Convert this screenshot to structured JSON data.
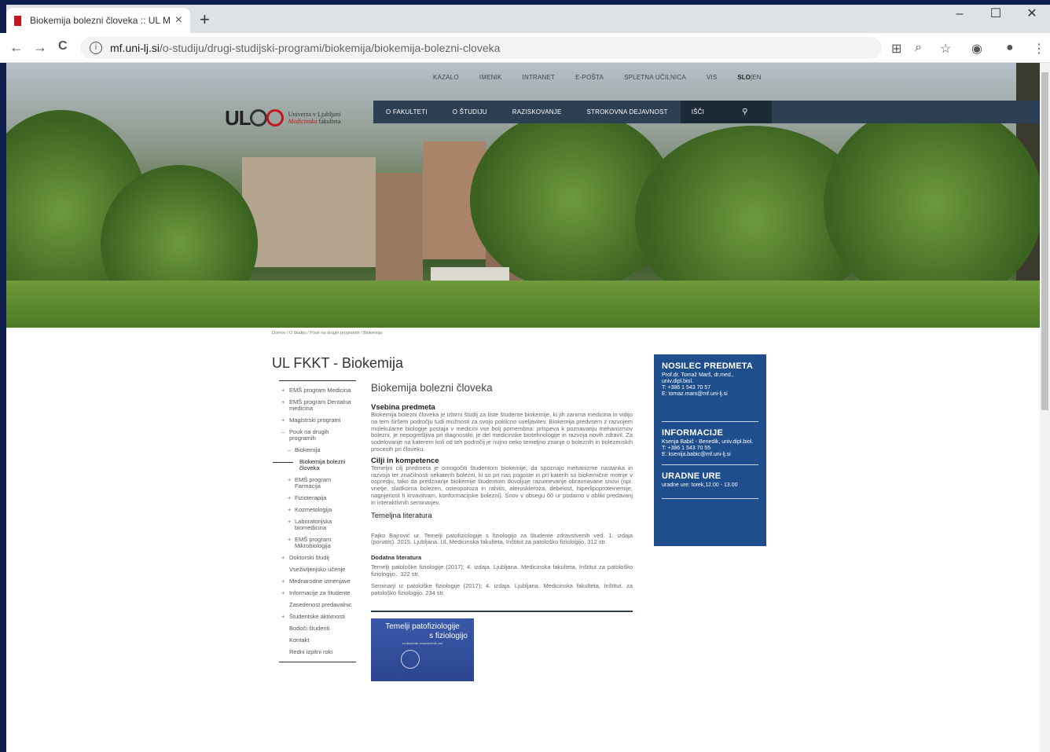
{
  "browser": {
    "tab_title": "Biokemija bolezni človeka :: UL M",
    "tab_close": "×",
    "new_tab": "+",
    "url_host": "mf.uni-lj.si",
    "url_path": "/o-studiju/drugi-studijski-programi/biokemija/biokemija-bolezni-cloveka",
    "info_glyph": "i",
    "min_glyph": "–",
    "max_glyph": "☐",
    "close_glyph": "✕",
    "back_glyph": "←",
    "forward_glyph": "→",
    "reload_glyph": "C",
    "translate_glyph": "⊞",
    "zoom_glyph": "⌕",
    "star_glyph": "☆",
    "ext_glyph": "◉",
    "profile_glyph": "●",
    "menu_glyph": "⋮"
  },
  "utility_nav": [
    "KAZALO",
    "IMENIK",
    "INTRANET",
    "E-POŠTA",
    "SPLETNA UČILNICA",
    "VIS"
  ],
  "lang": {
    "slo": "SLO",
    "sep": " | ",
    "en": "EN"
  },
  "logo": {
    "ul": "UL",
    "line1": "Univerza v Ljubljani",
    "line2a": "Medicinska",
    "line2b": " fakulteta"
  },
  "main_nav": {
    "items": [
      "O FAKULTETI",
      "O ŠTUDIJU",
      "RAZISKOVANJE",
      "STROKOVNA DEJAVNOST"
    ],
    "search": "IŠČI",
    "search_glyph": "⚲"
  },
  "breadcrumb": "Domov / O študiju / Pouk na drugih programih / Biokemija",
  "page_title": "UL FKKT - Biokemija",
  "left_nav": [
    {
      "label": "EMŠ program Medicina",
      "bullet": "+",
      "level": 0
    },
    {
      "label": "EMŠ program Dentalna medicina",
      "bullet": "+",
      "level": 0
    },
    {
      "label": "Magistrski programi",
      "bullet": "+",
      "level": 0
    },
    {
      "label": "Pouk na drugih programih",
      "bullet": "–",
      "level": 0
    },
    {
      "label": "Biokemija",
      "bullet": "–",
      "level": 1
    },
    {
      "label": "Biokemija bolezni človeka",
      "bullet": "",
      "level": 2
    },
    {
      "label": "EMŠ program Farmacija",
      "bullet": "+",
      "level": 1
    },
    {
      "label": "Fizioterapija",
      "bullet": "+",
      "level": 1
    },
    {
      "label": "Kozmetologija",
      "bullet": "+",
      "level": 1
    },
    {
      "label": "Laboratorijska biomedicina",
      "bullet": "+",
      "level": 1
    },
    {
      "label": "EMŠ program Mikrobiologija",
      "bullet": "+",
      "level": 1
    },
    {
      "label": "Doktorski študij",
      "bullet": "+",
      "level": 0
    },
    {
      "label": "Vseživljenjsko učenje",
      "bullet": "",
      "level": 0
    },
    {
      "label": "Mednarodne izmenjave",
      "bullet": "+",
      "level": 0
    },
    {
      "label": "Informacije za študente",
      "bullet": "+",
      "level": 0
    },
    {
      "label": "Zasedenost predavalnic",
      "bullet": "",
      "level": 0
    },
    {
      "label": "Študentske aktivnosti",
      "bullet": "+",
      "level": 0
    },
    {
      "label": "Bodoči študenti",
      "bullet": "",
      "level": 0
    },
    {
      "label": "Kontakt",
      "bullet": "",
      "level": 0
    },
    {
      "label": "Redni izpitni roki",
      "bullet": "",
      "level": 0
    }
  ],
  "content": {
    "title": "Biokemija bolezni človeka",
    "h_vsebina": "Vsebina predmeta",
    "vsebina": "Biokemija bolezni človeka je izbirni študij za tiste študente biokemije, ki jih zanima medicina in vidijo na tem širšem področju tudi možnosti za svojo poklicno uveljavitev. Biokemija predvsem z razvojem molekularne biologije postaja v medicini vse bolj pomembna: prispeva k poznavanju mehanizmov bolezni, je nepogrešljiva pri diagnostiki, je del medicinske biotehnologije in razvoja novih zdravil. Za sodelovanje na katerem koli od teh področij je nujno neko temeljno znanje o boleznih in bolezenskih procesih pri človeku.",
    "h_cilji": "Cilji in kompetence",
    "cilji": "Temeljni cilj predmeta je omogočiti študentom biokemije, da spoznajo mehanizme nastanka in razvoja ter značilnosti nekaterih bolezni, ki so pri nas pogoste in pri katerih so biokemične motnje v ospredju, tako da predznanje biokemije študentom dovoljuje razumevanje obravnavane snovi (npr. vnetje, sladkorna bolezen, osteoporoza in rahitis, ateroskleroza, debelost, hiperlipoproteinemije, nagnjenost h krvavitvam, konformacijske bolezni). Snov v obsegu 60 ur podamo v obliki predavanj in interaktivnih seminarjev.",
    "h_temeljna": "Temeljna literatura",
    "temeljna": "Fajko Bajrović ur. Temelji patofiziologije s fiziologijo za študente zdravstvenih ved. 1. izdaja (ponatis). 2015. Ljubljana. UL Medicinska fakulteta, Inštitut za patološko fiziologijo. 312 str.",
    "h_dodatna": "Dodatna literatura",
    "dodatna1": "Temelji patološke fiziologije (2017); 4. izdaja. Ljubljana. Medicinska fakulteta, Inštitut za patološko fiziologijo.. 322 str.",
    "dodatna2": "Seminarji iz patološke fiziologije (2017); 4. izdaja. Ljubljana. Medicinska fakulteta, Inštitut. za patološko fiziologijo. 234 str.",
    "book_title1": "Temelji patofiziologije",
    "book_title2": "s fiziologijo",
    "book_sub": "za študente zdravstvenih ved"
  },
  "sidebox": {
    "h1": "NOSILEC PREDMETA",
    "t1": [
      "Prof.dr. Tomaž Marš, dr.med., univ.dipl.biol.",
      "T: +386 1 543 70 57",
      "E: tomaz.mars@mf.uni-lj.si"
    ],
    "h2": "INFORMACIJE",
    "t2": [
      "Ksenja Babič - Benedik, univ.dipl.biol.",
      "T: +386 1 543 70 55",
      "E: ksenija.babic@mf.uni-lj.si"
    ],
    "h3": "URADNE URE",
    "t3": [
      "uradne ure: torek,12.00 - 13.00"
    ]
  },
  "colors": {
    "nav_bg": "#2d3f52",
    "side_bg": "#1f4e8c",
    "brand_red": "#c4161c"
  }
}
